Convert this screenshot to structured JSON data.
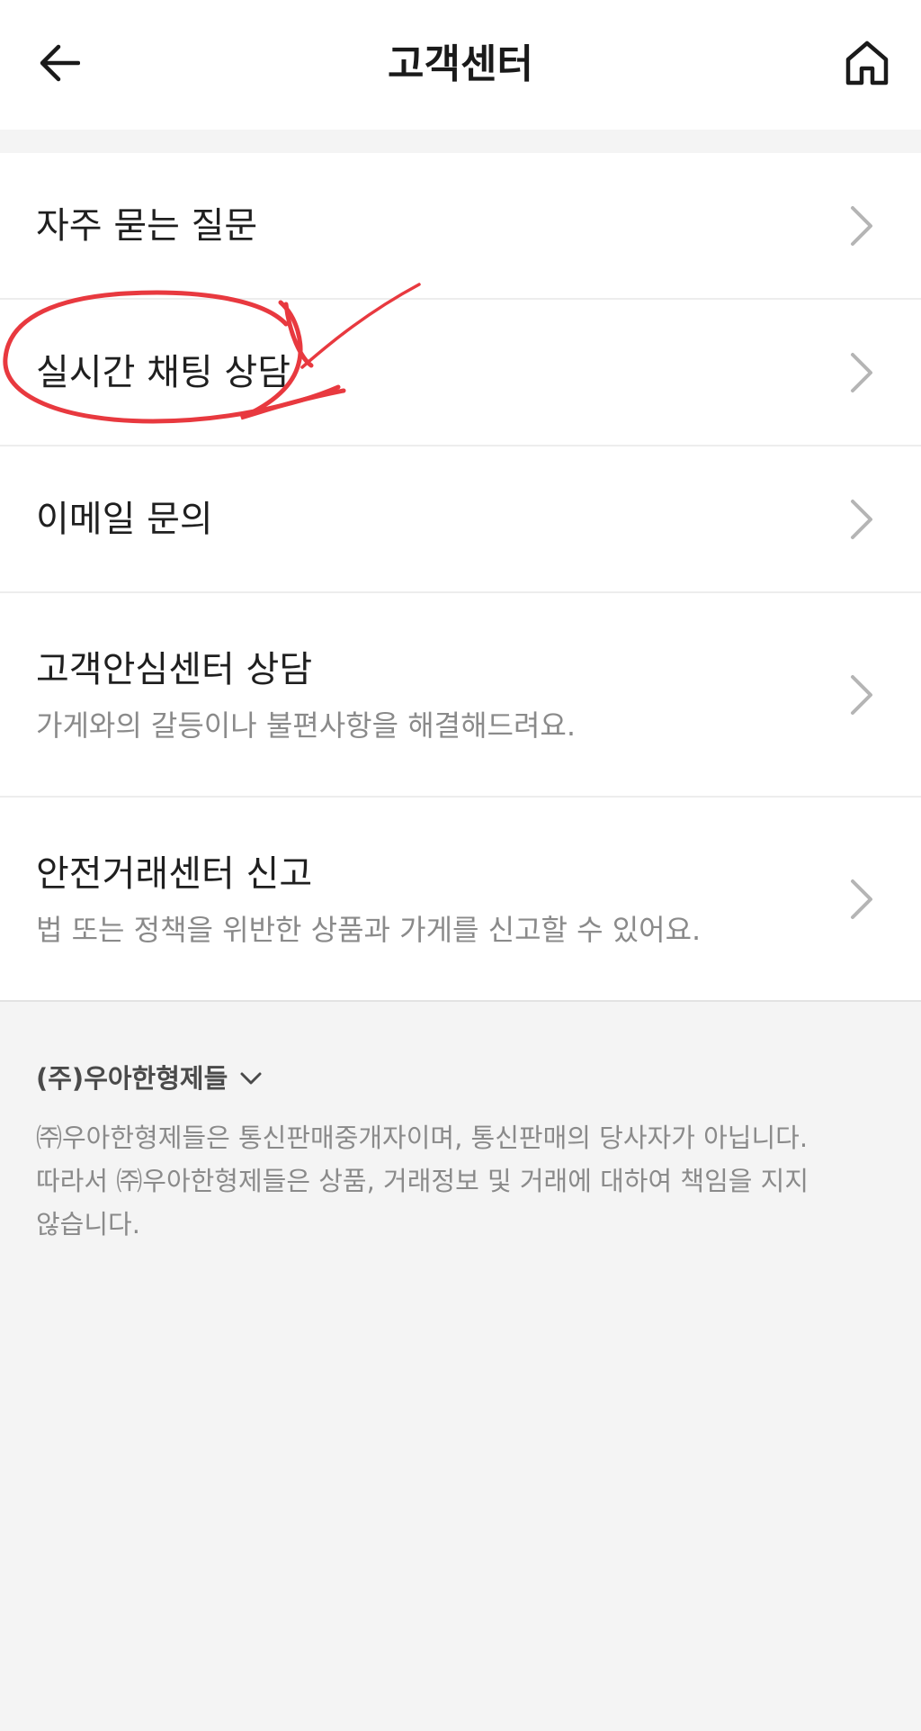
{
  "header": {
    "title": "고객센터",
    "back_icon": "arrow-left-icon",
    "home_icon": "home-icon"
  },
  "menu": {
    "items": [
      {
        "label": "자주 묻는 질문",
        "description": ""
      },
      {
        "label": "실시간 채팅 상담",
        "description": ""
      },
      {
        "label": "이메일 문의",
        "description": ""
      },
      {
        "label": "고객안심센터 상담",
        "description": "가게와의 갈등이나 불편사항을 해결해드려요."
      },
      {
        "label": "안전거래센터 신고",
        "description": "법 또는 정책을 위반한 상품과 가게를 신고할 수 있어요."
      }
    ]
  },
  "footer": {
    "company_name": "(주)우아한형제들",
    "disclaimer_line1": "㈜우아한형제들은 통신판매중개자이며, 통신판매의 당사자가 아닙니다.",
    "disclaimer_line2": "따라서 ㈜우아한형제들은 상품, 거래정보 및 거래에 대하여 책임을 지지",
    "disclaimer_line3": "않습니다."
  },
  "colors": {
    "annotation": "#e8393f",
    "background": "#f4f4f4",
    "chevron": "#b5b5b5"
  }
}
